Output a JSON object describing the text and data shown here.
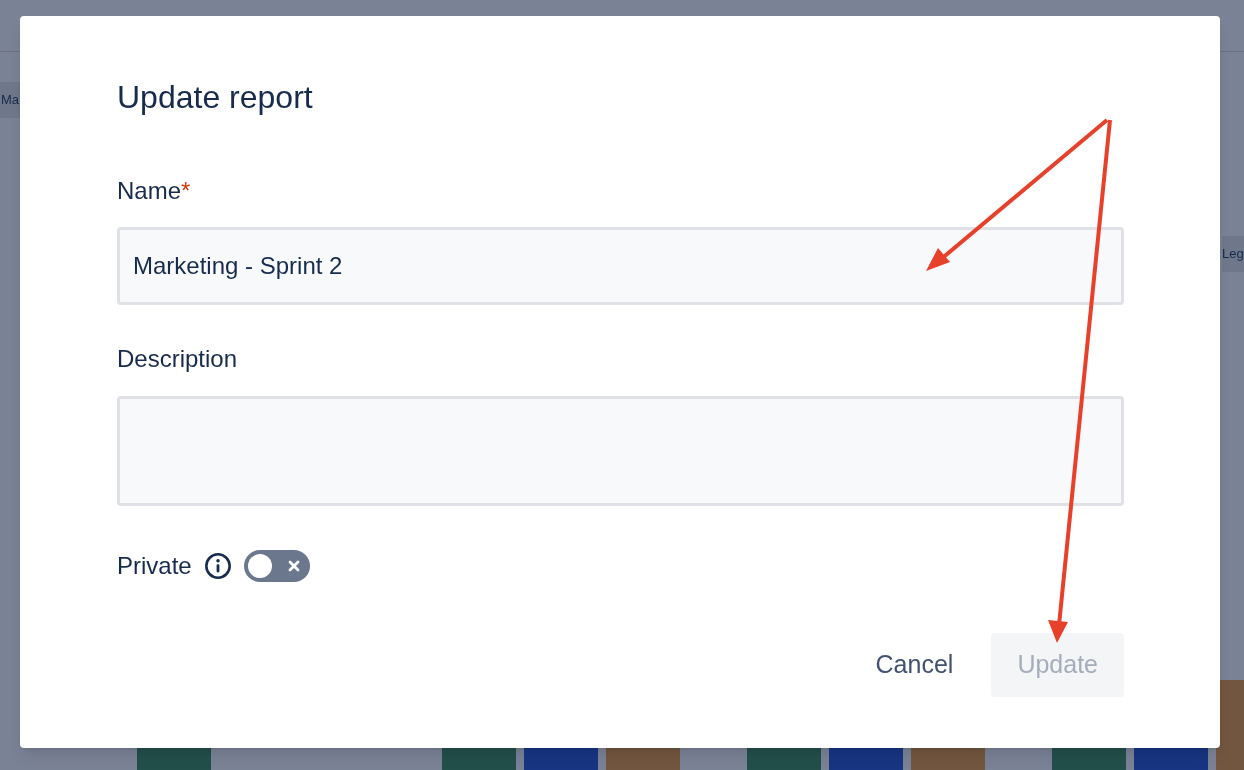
{
  "background": {
    "left_chip": "Ma",
    "right_chip": "Leg"
  },
  "dialog": {
    "title": "Update report",
    "fields": [
      {
        "kind": "input",
        "label": "Name",
        "required_mark": "*",
        "value": "Marketing - Sprint 2"
      },
      {
        "kind": "textarea",
        "label": "Description"
      }
    ],
    "private": {
      "label": "Private",
      "on": false
    },
    "buttons": [
      {
        "kind": "subtle",
        "label": "Cancel",
        "disabled": false
      },
      {
        "kind": "primary",
        "label": "Update",
        "disabled": true
      }
    ]
  }
}
